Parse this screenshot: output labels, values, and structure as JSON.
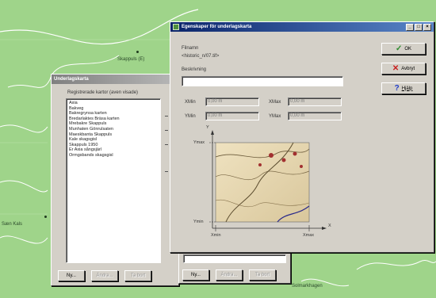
{
  "colors": {
    "map_background": "#9fd48a",
    "map_roads": "#ffffff",
    "title_active": "#0a246a",
    "title_inactive": "#808080",
    "window_face": "#d4d0c8"
  },
  "map": {
    "labels": [
      "Skappuls (E)",
      "Sæn Kals",
      "Solmarkhagen"
    ]
  },
  "list_window": {
    "title": "Underlagskarta",
    "list_heading": "Registrerade kartor (aven visade)",
    "items": [
      "Axia",
      "Bakveg",
      "Bakregrynsa karten",
      "Bredarlaktes Bräsa karten",
      "Mrebakre Skappuls",
      "Munhaten Gönrulsaten",
      "Maeskbanta Skappuls",
      "Kale skagsgisl",
      "Skappuls 1950",
      "Er Axia sångsjärl",
      "Ormgsbands skagsgisl"
    ],
    "buttons": {
      "new": "Ny...",
      "change": "Ändra...",
      "remove": "Ta bort"
    }
  },
  "props_window": {
    "title": "Egenskaper för underlagskarta",
    "file_label": "Filnamn",
    "file_value": "<historic_n/07.tif>",
    "description_label": "Beskrivning",
    "description_value": "",
    "xmin_label": "XMin",
    "xmin_value": "0,00 m",
    "xmax_label": "XMax",
    "xmax_value": "0,00 m",
    "ymin_label": "YMin",
    "ymin_value": "0,00 m",
    "ymax_label": "YMax",
    "ymax_value": "0,00 m",
    "diagram": {
      "y_max_label": "Ymax",
      "y_min_label": "Ymin",
      "y_axis_label": "Y",
      "x_min_label": "Xmin",
      "x_max_label": "Xmax",
      "x_axis_label": "X"
    },
    "buttons": {
      "ok": "OK",
      "cancel": "Avbryt",
      "help": "Hjälp"
    },
    "title_controls": [
      "_",
      "□",
      "×"
    ]
  },
  "bottom_strip": {
    "buttons": {
      "new": "Ny...",
      "change": "Ändra...",
      "remove": "Ta bort"
    }
  }
}
